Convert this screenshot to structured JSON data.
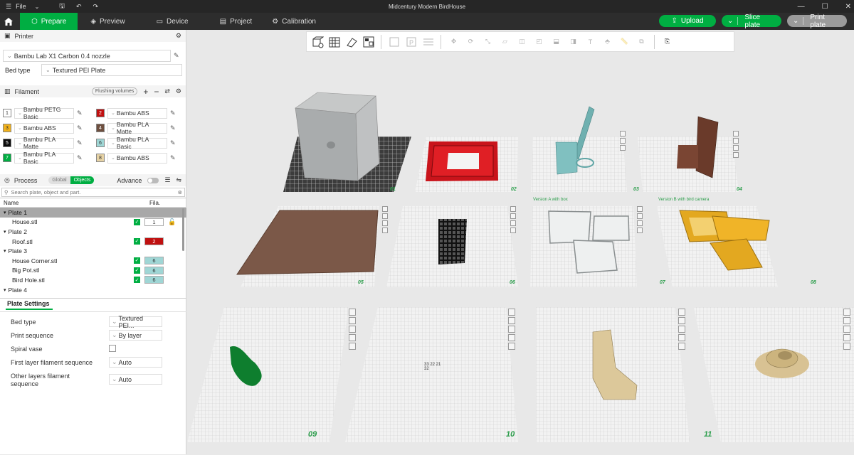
{
  "titlebar": {
    "file_label": "File",
    "window_title": "Midcentury Modern BirdHouse",
    "minimize": "—",
    "maximize": "☐",
    "close": "✕"
  },
  "nav": {
    "tabs": [
      {
        "label": "Prepare",
        "icon": "cube-icon"
      },
      {
        "label": "Preview",
        "icon": "layers-icon"
      },
      {
        "label": "Device",
        "icon": "monitor-icon"
      },
      {
        "label": "Project",
        "icon": "file-icon"
      },
      {
        "label": "Calibration",
        "icon": "gear-icon"
      }
    ],
    "upload_label": "Upload",
    "slice_label": "Slice plate",
    "print_label": "Print plate"
  },
  "printer": {
    "section_label": "Printer",
    "name": "Bambu Lab X1 Carbon 0.4 nozzle",
    "bed_type_label": "Bed type",
    "bed_type_value": "Textured PEI Plate"
  },
  "filament": {
    "section_label": "Filament",
    "flushing_label": "Flushing volumes",
    "items": [
      {
        "num": "1",
        "name": "Bambu PETG Basic",
        "color": "#ffffff",
        "text": "#333"
      },
      {
        "num": "2",
        "name": "Bambu ABS",
        "color": "#c01010",
        "text": "#fff"
      },
      {
        "num": "3",
        "name": "Bambu ABS",
        "color": "#f2b21b",
        "text": "#333"
      },
      {
        "num": "4",
        "name": "Bambu PLA Matte",
        "color": "#6e4f3f",
        "text": "#fff"
      },
      {
        "num": "5",
        "name": "Bambu PLA Matte",
        "color": "#0a0a0a",
        "text": "#fff"
      },
      {
        "num": "6",
        "name": "Bambu PLA Basic",
        "color": "#9fd6d5",
        "text": "#333"
      },
      {
        "num": "7",
        "name": "Bambu PLA Basic",
        "color": "#00ae42",
        "text": "#fff"
      },
      {
        "num": "8",
        "name": "Bambu ABS",
        "color": "#e6d2a4",
        "text": "#333"
      }
    ]
  },
  "process": {
    "section_label": "Process",
    "global_label": "Global",
    "objects_label": "Objects",
    "advance_label": "Advance",
    "search_placeholder": "Search plate, object and part."
  },
  "tree": {
    "col_name": "Name",
    "col_fil": "Fila.",
    "rows": [
      {
        "type": "plate",
        "label": "Plate 1",
        "sel": true
      },
      {
        "type": "obj",
        "label": "House.stl",
        "fil": "1",
        "fc": "#ffffff",
        "ft": "#333"
      },
      {
        "type": "plate",
        "label": "Plate 2"
      },
      {
        "type": "obj",
        "label": "Roof.stl",
        "fil": "2",
        "fc": "#c01010",
        "ft": "#fff"
      },
      {
        "type": "plate",
        "label": "Plate 3"
      },
      {
        "type": "obj",
        "label": "House Corner.stl",
        "fil": "6",
        "fc": "#9fd6d5",
        "ft": "#333"
      },
      {
        "type": "obj",
        "label": "Big Pot.stl",
        "fil": "6",
        "fc": "#9fd6d5",
        "ft": "#333"
      },
      {
        "type": "obj",
        "label": "Bird Hole.stl",
        "fil": "6",
        "fc": "#9fd6d5",
        "ft": "#333"
      },
      {
        "type": "plate",
        "label": "Plate 4"
      }
    ]
  },
  "plate_settings": {
    "tab_label": "Plate Settings",
    "bed_type_label": "Bed type",
    "bed_type_value": "Textured PEI...",
    "print_seq_label": "Print sequence",
    "print_seq_value": "By layer",
    "spiral_label": "Spiral vase",
    "first_layer_label": "First layer filament sequence",
    "first_layer_value": "Auto",
    "other_layers_label_1": "Other layers filament",
    "other_layers_label_2": "sequence",
    "other_layers_value": "Auto"
  },
  "plates": {
    "labels": [
      "01",
      "02",
      "03",
      "04",
      "05",
      "06",
      "07",
      "08",
      "09",
      "10",
      "11"
    ],
    "version_a": "Version A with box",
    "version_b": "Version B with bird camera",
    "tiny_text": "33 22 21 32"
  }
}
